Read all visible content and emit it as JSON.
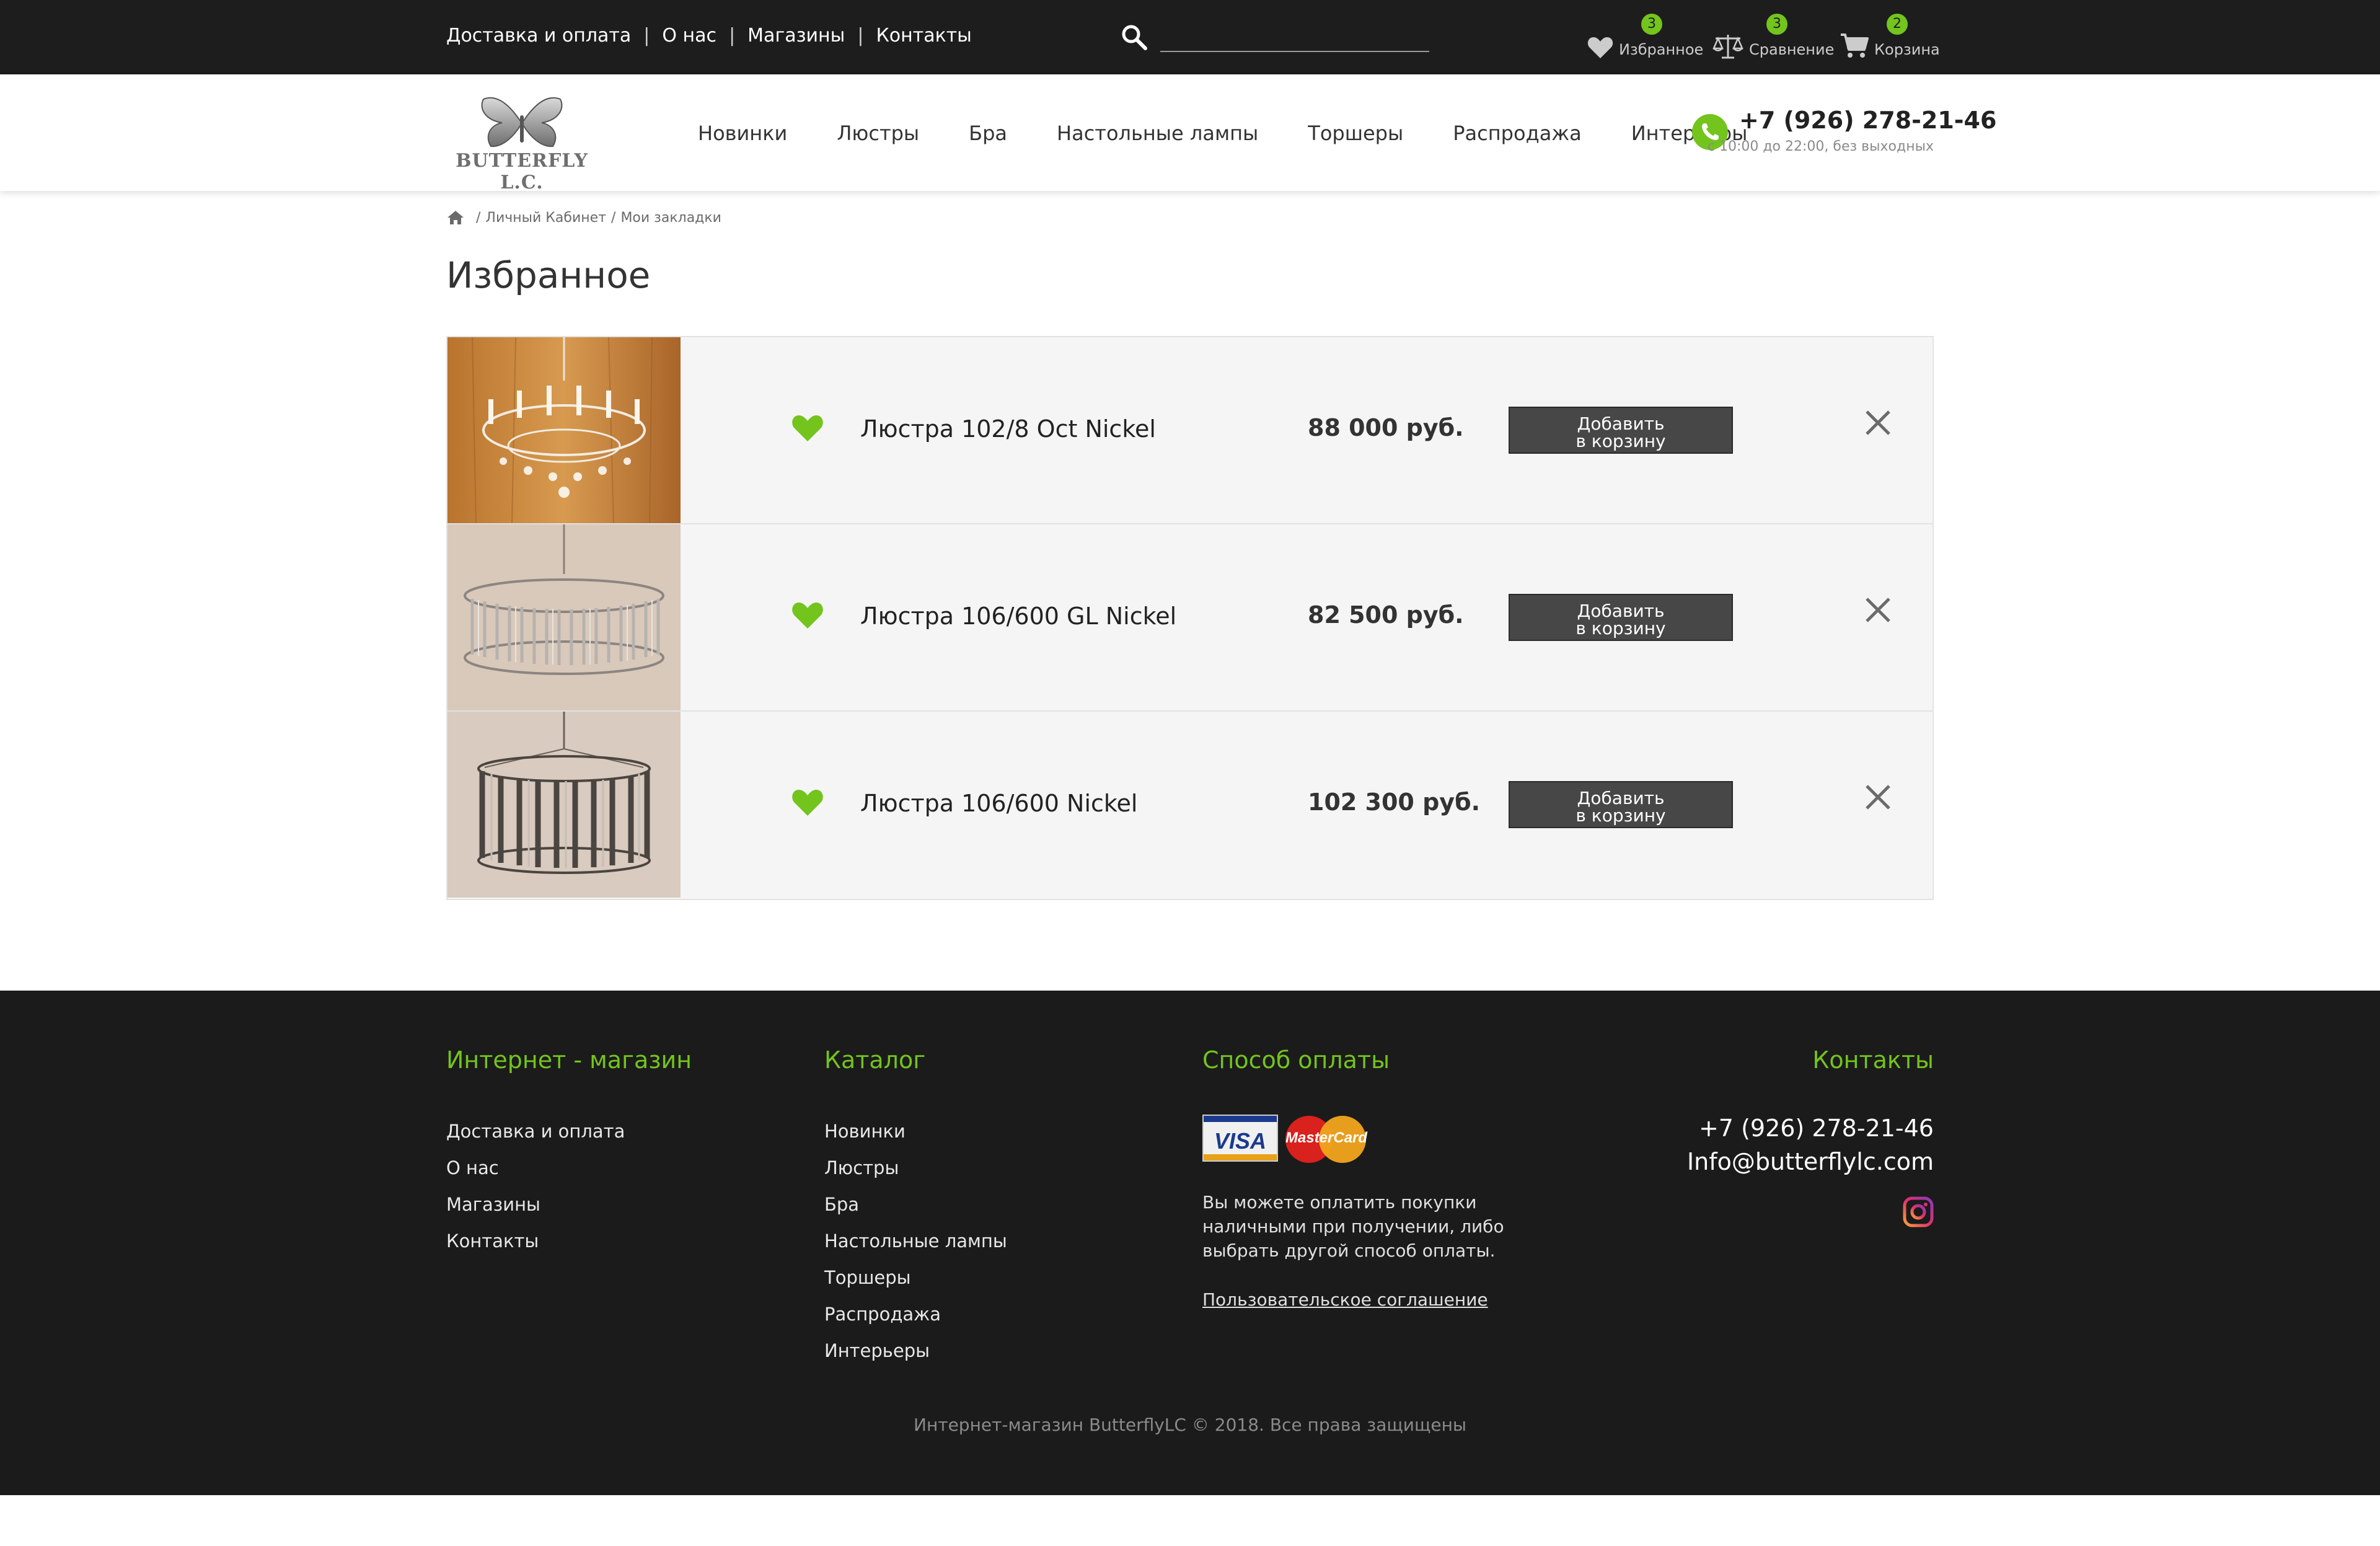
{
  "topbar": {
    "links": [
      "Доставка и оплата",
      "О нас",
      "Магазины",
      "Контакты"
    ],
    "separator": "|",
    "search": {
      "placeholder": ""
    },
    "favorites": {
      "label": "Избранное",
      "count": "3"
    },
    "compare": {
      "label": "Сравнение",
      "count": "3"
    },
    "cart": {
      "label": "Корзина",
      "count": "2"
    }
  },
  "header": {
    "logo_text": "BUTTERFLY L.C.",
    "nav": [
      "Новинки",
      "Люстры",
      "Бра",
      "Настольные лампы",
      "Торшеры",
      "Распродажа",
      "Интерьеры"
    ],
    "phone": "+7 (926) 278-21-46",
    "hours": "с 10:00 до 22:00, без выходных"
  },
  "breadcrumb": {
    "separator": "/",
    "items": [
      "Личный Кабинет",
      "Мои закладки"
    ]
  },
  "page_title": "Избранное",
  "favorites": [
    {
      "name": "Люстра 102/8 Oct Nickel",
      "price": "88 000 руб.",
      "button_line1": "Добавить",
      "button_line2": "в корзину"
    },
    {
      "name": "Люстра 106/600 GL Nickel",
      "price": "82 500 руб.",
      "button_line1": "Добавить",
      "button_line2": "в корзину"
    },
    {
      "name": "Люстра 106/600 Nickel",
      "price": "102 300 руб.",
      "button_line1": "Добавить",
      "button_line2": "в корзину"
    }
  ],
  "footer": {
    "shop": {
      "heading": "Интернет - магазин",
      "links": [
        "Доставка и оплата",
        "О нас",
        "Магазины",
        "Контакты"
      ]
    },
    "catalog": {
      "heading": "Каталог",
      "links": [
        "Новинки",
        "Люстры",
        "Бра",
        "Настольные лампы",
        "Торшеры",
        "Распродажа",
        "Интерьеры"
      ]
    },
    "payment": {
      "heading": "Способ оплаты",
      "visa_label": "VISA",
      "mastercard_label": "MasterCard",
      "text": "Вы можете оплатить покупки наличными при получении, либо выбрать другой способ оплаты.",
      "agreement": "Пользовательское соглашение"
    },
    "contacts": {
      "heading": "Контакты",
      "phone": "+7 (926) 278-21-46",
      "email": "Info@butterflylc.com"
    },
    "copyright": "Интернет-магазин ButterflyLC © 2018. Все права защищены"
  },
  "colors": {
    "accent": "#73c41c",
    "dark_bg": "#1d1d1d",
    "button_bg": "#474747"
  },
  "icons": [
    "search-icon",
    "heart-icon",
    "scales-icon",
    "cart-icon",
    "logo-butterfly-icon",
    "phone-icon",
    "home-icon",
    "heart-icon",
    "close-icon",
    "instagram-icon"
  ]
}
